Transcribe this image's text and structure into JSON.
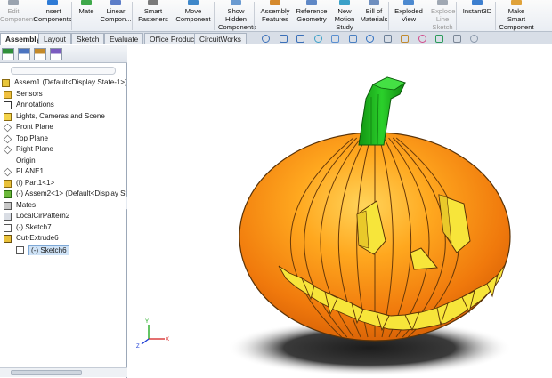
{
  "ribbon": {
    "buttons": [
      {
        "label": "Edit\nComponent",
        "enabled": false
      },
      {
        "label": "Insert\nComponents",
        "enabled": true
      },
      {
        "label": "Mate",
        "enabled": true
      },
      {
        "label": "Linear\nCompon...",
        "enabled": true
      },
      {
        "label": "Smart\nFasteners",
        "enabled": true
      },
      {
        "label": "Move\nComponent",
        "enabled": true
      },
      {
        "label": "Show\nHidden\nComponents",
        "enabled": true
      },
      {
        "label": "Assembly\nFeatures",
        "enabled": true
      },
      {
        "label": "Reference\nGeometry",
        "enabled": true
      },
      {
        "label": "New\nMotion\nStudy",
        "enabled": true
      },
      {
        "label": "Bill of\nMaterials",
        "enabled": true
      },
      {
        "label": "Exploded\nView",
        "enabled": true
      },
      {
        "label": "Explode\nLine\nSketch",
        "enabled": false
      },
      {
        "label": "Instant3D",
        "enabled": true
      },
      {
        "label": "Make\nSmart\nComponent",
        "enabled": true
      }
    ]
  },
  "tabs": [
    "Assembly",
    "Layout",
    "Sketch",
    "Evaluate",
    "Office Products",
    "CircuitWorks"
  ],
  "active_tab": "Assembly",
  "view_toolbar_icons": [
    "zoom-to-fit-icon",
    "zoom-to-area-icon",
    "previous-view-icon",
    "section-view-icon",
    "rotate-view-icon",
    "pan-icon",
    "view-orientation-icon",
    "display-style-icon",
    "hide-show-items-icon",
    "edit-appearance-icon",
    "apply-scene-icon",
    "view-settings-icon",
    "help-icon"
  ],
  "panel_tabs": [
    "feature-manager-icon",
    "property-manager-icon",
    "configuration-manager-icon",
    "dim-xpert-icon"
  ],
  "tree": [
    {
      "label": "Assem1  (Default<Display State-1>)",
      "icon": "assembly-icon",
      "indent": 0
    },
    {
      "label": "Sensors",
      "icon": "sensors-icon",
      "indent": 1
    },
    {
      "label": "Annotations",
      "icon": "annotations-icon",
      "indent": 1
    },
    {
      "label": "Lights, Cameras and Scene",
      "icon": "lights-icon",
      "indent": 1
    },
    {
      "label": "Front Plane",
      "icon": "plane-icon",
      "indent": 1
    },
    {
      "label": "Top Plane",
      "icon": "plane-icon",
      "indent": 1
    },
    {
      "label": "Right Plane",
      "icon": "plane-icon",
      "indent": 1
    },
    {
      "label": "Origin",
      "icon": "origin-icon",
      "indent": 1
    },
    {
      "label": "PLANE1",
      "icon": "plane-icon",
      "indent": 1
    },
    {
      "label": "(f) Part1<1>",
      "icon": "part-icon",
      "indent": 1
    },
    {
      "label": "(-) Assem2<1> (Default<Display Sta",
      "icon": "subassembly-icon",
      "indent": 1
    },
    {
      "label": "Mates",
      "icon": "mates-icon",
      "indent": 1
    },
    {
      "label": "LocalCirPattern2",
      "icon": "pattern-icon",
      "indent": 1
    },
    {
      "label": "(-) Sketch7",
      "icon": "sketch-icon",
      "indent": 1
    },
    {
      "label": "Cut-Extrude6",
      "icon": "cut-extrude-icon",
      "indent": 1
    },
    {
      "label": "(-) Sketch6",
      "icon": "sketch-icon",
      "indent": 2,
      "selected": true
    }
  ],
  "colors": {
    "pumpkin": "#f58a12",
    "pumpkin_light": "#ffc24a",
    "stem": "#1fb51f",
    "cutout": "#f7e53a",
    "edge": "#3a2206"
  }
}
